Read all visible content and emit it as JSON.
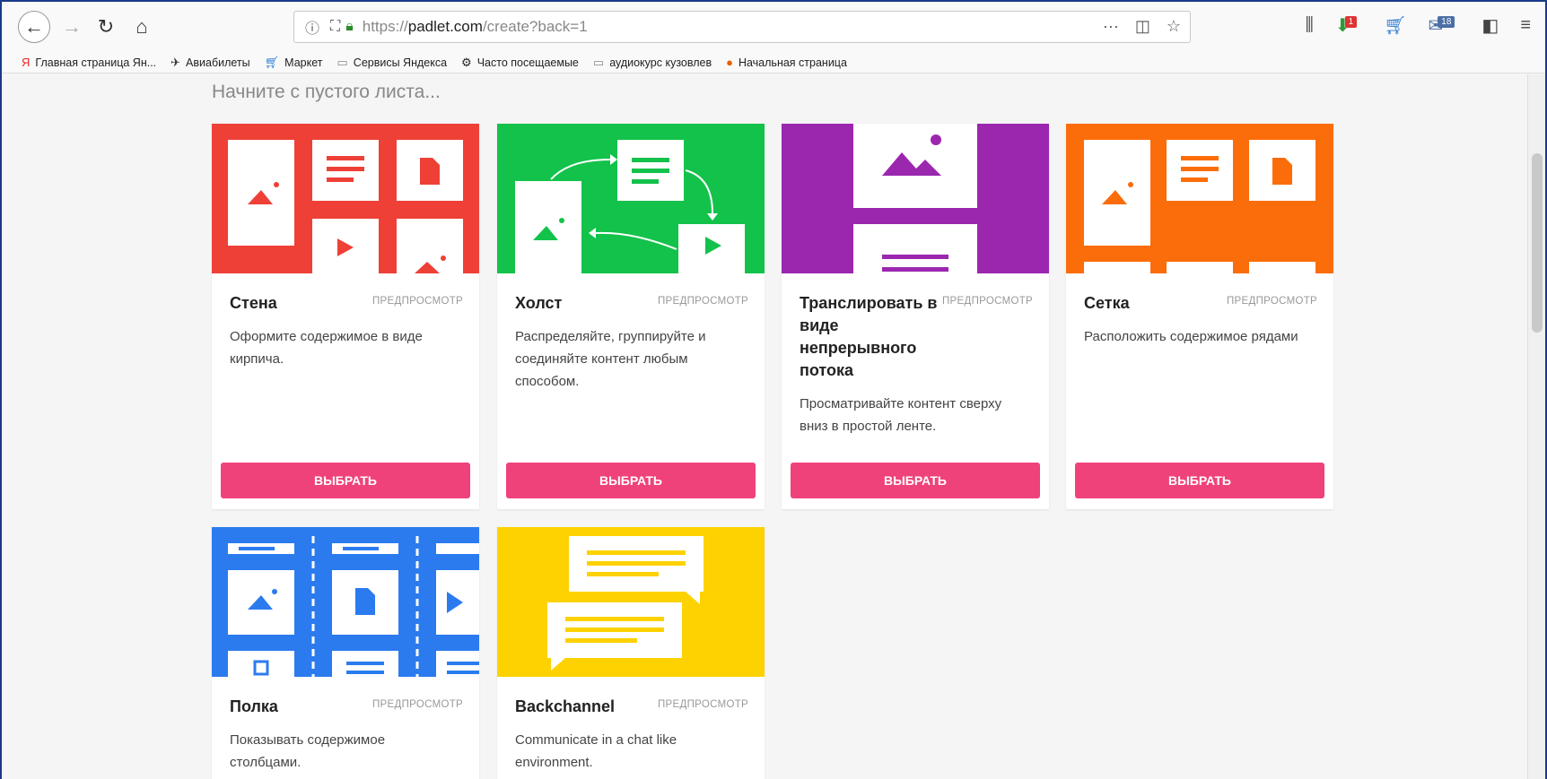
{
  "browser": {
    "url_prefix": "https://",
    "url_domain": "padlet.com",
    "url_path": "/create?back=1"
  },
  "bookmarks": [
    {
      "icon": "yandex-icon",
      "label": "Главная страница Ян..."
    },
    {
      "icon": "plane-icon",
      "label": "Авиабилеты"
    },
    {
      "icon": "cart-icon",
      "label": "Маркет"
    },
    {
      "icon": "folder-icon",
      "label": "Сервисы Яндекса"
    },
    {
      "icon": "gear-icon",
      "label": "Часто посещаемые"
    },
    {
      "icon": "folder-icon",
      "label": "аудиокурс кузовлев"
    },
    {
      "icon": "firefox-icon",
      "label": "Начальная страница"
    }
  ],
  "toolbar_badges": {
    "ext1": "1",
    "ext2": "18"
  },
  "page": {
    "section_title": "Начните с пустого листа..."
  },
  "cards": [
    {
      "name": "Стена",
      "preview": "ПРЕДПРОСМОТР",
      "desc": "Оформите содержимое в виде кирпича.",
      "button": "ВЫБРАТЬ",
      "color": "#ee4037"
    },
    {
      "name": "Холст",
      "preview": "ПРЕДПРОСМОТР",
      "desc": "Распределяйте, группируйте и соединяйте контент любым способом.",
      "button": "ВЫБРАТЬ",
      "color": "#13c24a"
    },
    {
      "name": "Транслировать в виде непрерывного потока",
      "preview": "ПРЕДПРОСМОТР",
      "desc": "Просматривайте контент сверху вниз в простой ленте.",
      "button": "ВЫБРАТЬ",
      "color": "#9b27af"
    },
    {
      "name": "Сетка",
      "preview": "ПРЕДПРОСМОТР",
      "desc": "Расположить содержимое рядами",
      "button": "ВЫБРАТЬ",
      "color": "#fb6d0a"
    },
    {
      "name": "Полка",
      "preview": "ПРЕДПРОСМОТР",
      "desc": "Показывать содержимое столбцами.",
      "color": "#2b7bef"
    },
    {
      "name": "Backchannel",
      "preview": "ПРЕДПРОСМОТР",
      "desc": "Communicate in a chat like environment.",
      "color": "#fdd200"
    }
  ]
}
